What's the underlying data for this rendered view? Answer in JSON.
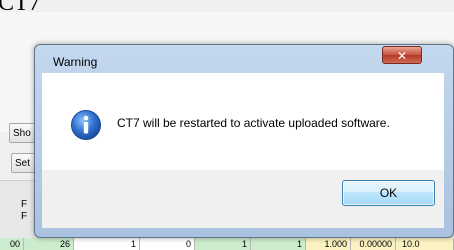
{
  "background_app": {
    "title": "CT7",
    "buttons": {
      "show_label": "Sho",
      "set_label": "Set"
    },
    "table": {
      "header_line1": "F",
      "header_line2": "F",
      "row": [
        "00",
        "26",
        "1",
        "0",
        "1",
        "1",
        "1.000",
        "0.00000",
        "10.0"
      ]
    }
  },
  "dialog": {
    "title": "Warning",
    "close_glyph": "✕",
    "icon": "info-icon",
    "message": "CT7 will be restarted to activate uploaded software.",
    "ok_label": "OK"
  },
  "colors": {
    "close_button": "#c8533f",
    "ok_button_border": "#3c7fb1",
    "info_icon": "#2f6fcf",
    "row_green": "#cdeccd",
    "row_yellow": "#fbf2c2"
  }
}
